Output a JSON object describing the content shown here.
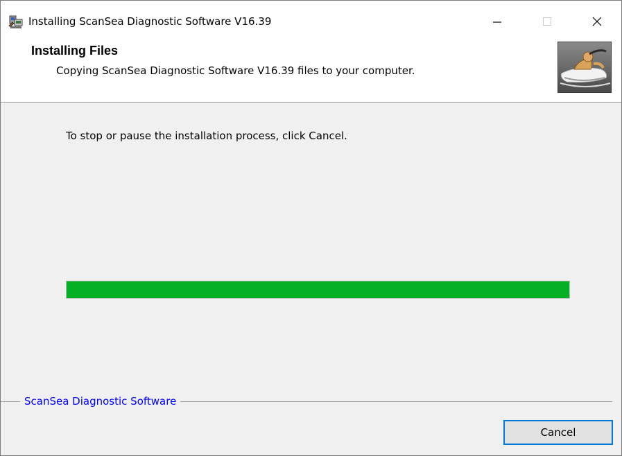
{
  "window": {
    "title": "Installing ScanSea Diagnostic Software V16.39",
    "controls": {
      "minimize_icon": "minimize-icon",
      "maximize_icon": "maximize-icon",
      "close_icon": "close-icon"
    }
  },
  "header": {
    "title": "Installing Files",
    "subtitle": "Copying ScanSea Diagnostic Software V16.39 files to your computer.",
    "image_icon": "jetski-logo-icon"
  },
  "body": {
    "instruction": "To stop or pause the installation process, click Cancel.",
    "progress": {
      "percent": 100,
      "fill_color": "#06b025"
    }
  },
  "footer": {
    "group_label": "ScanSea Diagnostic Software",
    "cancel_label": "Cancel"
  },
  "colors": {
    "accent": "#0078d7",
    "link": "#0000ff"
  }
}
